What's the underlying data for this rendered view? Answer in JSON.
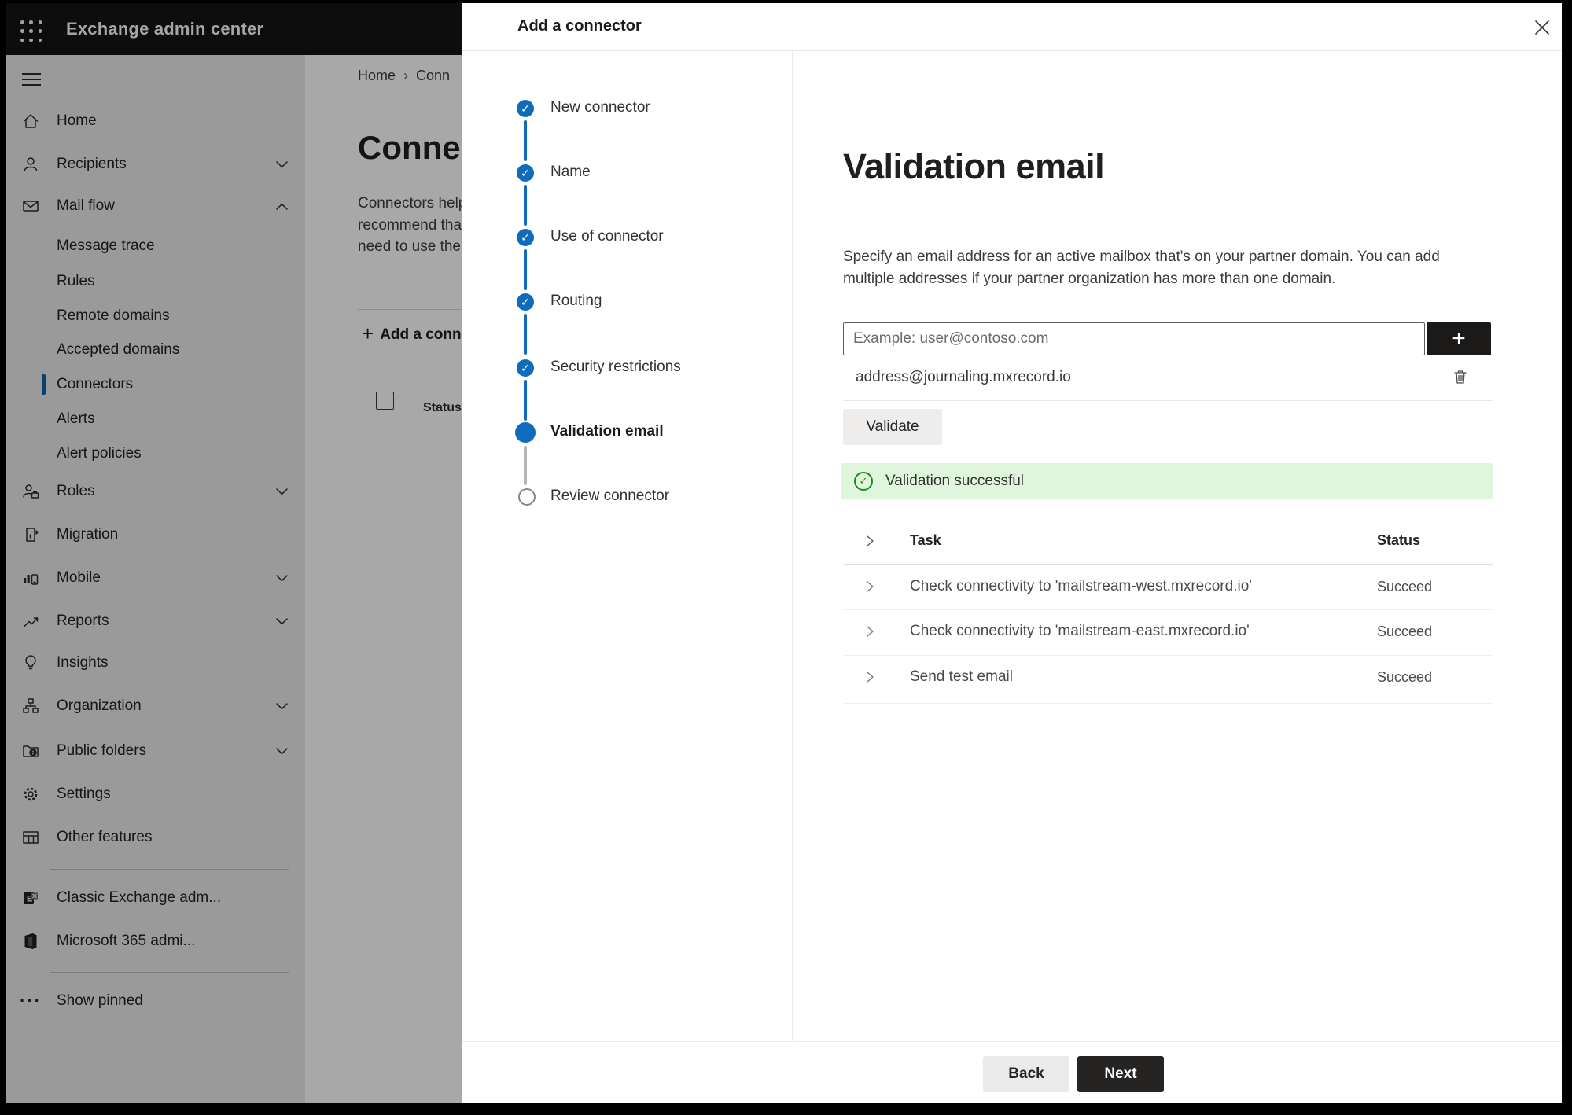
{
  "topbar": {
    "title": "Exchange admin center"
  },
  "sidebar": {
    "items": [
      {
        "label": "Home",
        "icon": "home"
      },
      {
        "label": "Recipients",
        "icon": "person",
        "expand": "down"
      },
      {
        "label": "Mail flow",
        "icon": "envelope",
        "expand": "up"
      },
      {
        "label": "Message trace"
      },
      {
        "label": "Rules"
      },
      {
        "label": "Remote domains"
      },
      {
        "label": "Accepted domains"
      },
      {
        "label": "Connectors",
        "selected": true
      },
      {
        "label": "Alerts"
      },
      {
        "label": "Alert policies"
      },
      {
        "label": "Roles",
        "icon": "person-briefcase",
        "expand": "down"
      },
      {
        "label": "Migration",
        "icon": "page-arrow"
      },
      {
        "label": "Mobile",
        "icon": "chart-phone",
        "expand": "down"
      },
      {
        "label": "Reports",
        "icon": "line-chart",
        "expand": "down"
      },
      {
        "label": "Insights",
        "icon": "lightbulb"
      },
      {
        "label": "Organization",
        "icon": "org-tree",
        "expand": "down"
      },
      {
        "label": "Public folders",
        "icon": "folder-globe",
        "expand": "down"
      },
      {
        "label": "Settings",
        "icon": "gear"
      },
      {
        "label": "Other features",
        "icon": "table-grid"
      },
      {
        "label": "Classic Exchange adm...",
        "icon": "exchange-logo"
      },
      {
        "label": "Microsoft 365 admi...",
        "icon": "office-logo"
      },
      {
        "label": "Show pinned",
        "icon": "ellipsis"
      }
    ]
  },
  "background_page": {
    "breadcrumb_home": "Home",
    "breadcrumb_separator": "›",
    "breadcrumb_current": "Conn",
    "heading": "Connec",
    "description_lines": [
      "Connectors help",
      "recommend tha",
      "need to use the"
    ],
    "add_button_label": "Add a conn",
    "list_header": "Status"
  },
  "modal": {
    "title": "Add a connector",
    "steps": [
      {
        "label": "New connector",
        "state": "done"
      },
      {
        "label": "Name",
        "state": "done"
      },
      {
        "label": "Use of connector",
        "state": "done"
      },
      {
        "label": "Routing",
        "state": "done"
      },
      {
        "label": "Security restrictions",
        "state": "done"
      },
      {
        "label": "Validation email",
        "state": "current"
      },
      {
        "label": "Review connector",
        "state": "todo"
      }
    ],
    "check_glyph": "✓",
    "content": {
      "heading": "Validation email",
      "description_lines": [
        "Specify an email address for an active mailbox that's on your partner domain. You can add",
        "multiple addresses if your partner organization has more than one domain."
      ],
      "email_input_placeholder": "Example: user@contoso.com",
      "plus_glyph": "+",
      "added_address": "address@journaling.mxrecord.io",
      "validate_button": "Validate",
      "success_message": "Validation successful",
      "table": {
        "columns": [
          "Task",
          "Status"
        ],
        "rows": [
          {
            "task": "Check connectivity to 'mailstream-west.mxrecord.io'",
            "status": "Succeed"
          },
          {
            "task": "Check connectivity to 'mailstream-east.mxrecord.io'",
            "status": "Succeed"
          },
          {
            "task": "Send test email",
            "status": "Succeed"
          }
        ]
      }
    },
    "footer": {
      "back": "Back",
      "next": "Next"
    }
  },
  "colors": {
    "accent_blue": "#0f6cbd",
    "success_green": "#1e8a1e",
    "success_bg": "#dff6dd",
    "dark_button": "#1b1a19",
    "topbar_bg": "#141414"
  }
}
